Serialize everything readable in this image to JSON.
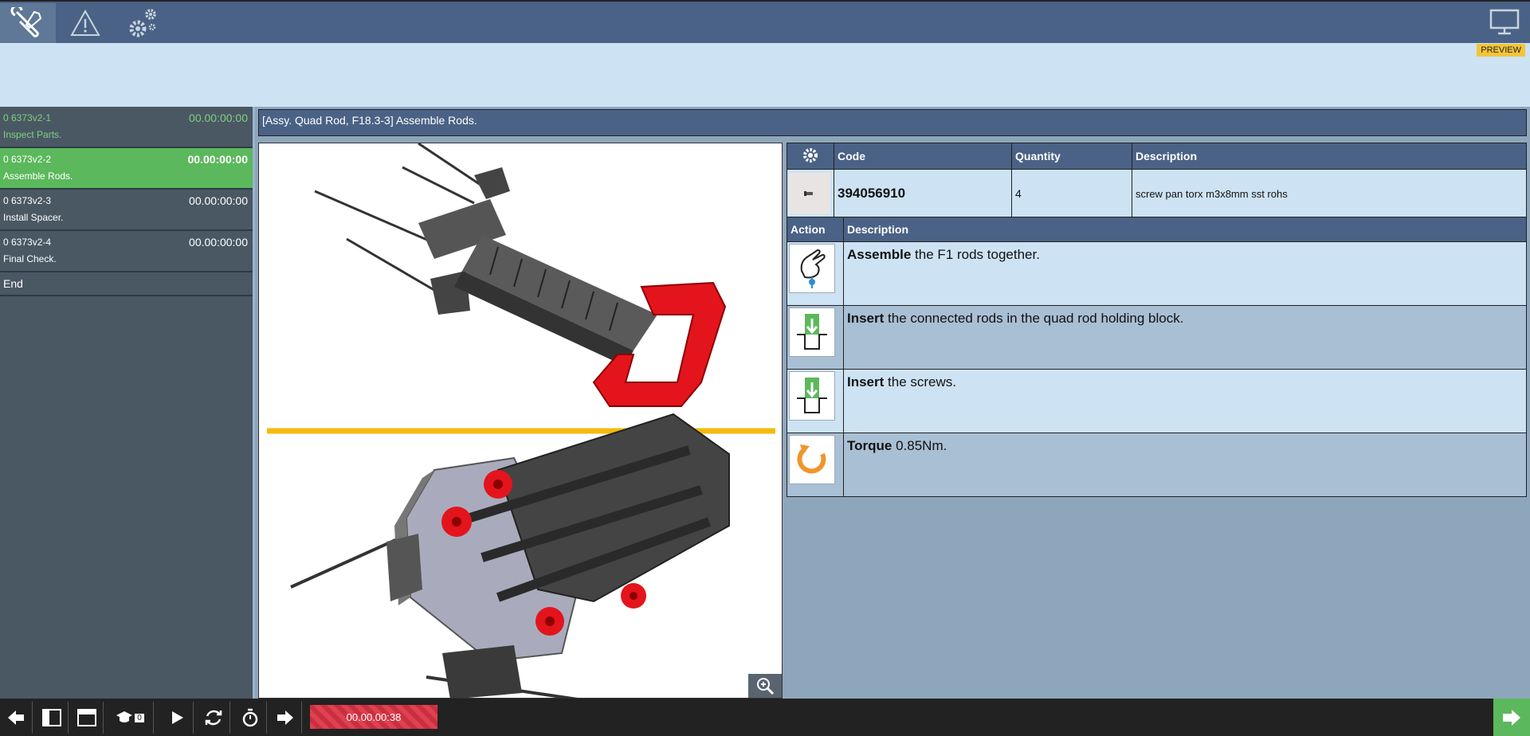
{
  "topbar": {
    "icons": [
      "wrench-screwdriver-icon",
      "warning-icon",
      "gears-icon"
    ],
    "preview_badge": "PREVIEW"
  },
  "steps": [
    {
      "id": "0 6373v2-1",
      "name": "Inspect Parts.",
      "time": "00.00:00:00",
      "state": "done"
    },
    {
      "id": "0 6373v2-2",
      "name": "Assemble Rods.",
      "time": "00.00:00:00",
      "state": "active"
    },
    {
      "id": "0 6373v2-3",
      "name": "Install Spacer.",
      "time": "00.00:00:00",
      "state": "pending"
    },
    {
      "id": "0 6373v2-4",
      "name": "Final Check.",
      "time": "00.00:00:00",
      "state": "pending"
    }
  ],
  "end_label": "End",
  "title": "[Assy. Quad Rod, F18.3-3] Assemble Rods.",
  "parts_table": {
    "headers": {
      "code": "Code",
      "quantity": "Quantity",
      "description": "Description"
    },
    "rows": [
      {
        "code": "394056910",
        "quantity": "4",
        "description": "screw pan torx m3x8mm sst rohs"
      }
    ]
  },
  "actions_table": {
    "headers": {
      "action": "Action",
      "description": "Description"
    },
    "rows": [
      {
        "icon": "hand-assemble-icon",
        "verb": "Assemble",
        "text": " the F1 rods together."
      },
      {
        "icon": "insert-icon",
        "verb": "Insert",
        "text": " the connected rods in the quad rod holding block."
      },
      {
        "icon": "insert-icon",
        "verb": "Insert",
        "text": " the screws."
      },
      {
        "icon": "torque-icon",
        "verb": "Torque",
        "text": " 0.85Nm."
      }
    ]
  },
  "bottombar": {
    "badge_count": "0",
    "timer": "00.00.00:38"
  },
  "colors": {
    "topbar": "#4a6285",
    "banner": "#cde3f4",
    "active_step": "#5cb85c",
    "timer": "#e04050",
    "badge": "#f4c53a"
  }
}
